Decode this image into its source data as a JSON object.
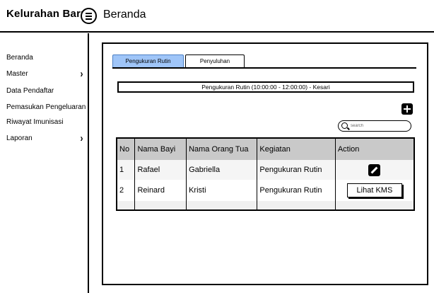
{
  "header": {
    "app_title": "Kelurahan Baru",
    "menu_icon": "hamburger-menu-icon",
    "page_title": "Beranda"
  },
  "sidebar": {
    "items": [
      {
        "label": "Beranda",
        "has_submenu": false
      },
      {
        "label": "Master",
        "has_submenu": true,
        "chevron": "›"
      },
      {
        "label": "Data Pendaftar",
        "has_submenu": false
      },
      {
        "label": "Pemasukan Pengeluaran",
        "has_submenu": false
      },
      {
        "label": "Riwayat Imunisasi",
        "has_submenu": false
      },
      {
        "label": "Laporan",
        "has_submenu": true,
        "chevron": "›"
      }
    ]
  },
  "main": {
    "tabs": [
      {
        "label": "Pengukuran Rutin",
        "active": true
      },
      {
        "label": "Penyuluhan",
        "active": false
      }
    ],
    "info_bar": "Pengukuran Rutin (10:00:00 - 12:00:00) - Kesari",
    "add_icon": "plus-icon",
    "search": {
      "placeholder": "search",
      "value": "",
      "icon": "search-icon"
    },
    "table": {
      "headers": [
        "No",
        "Nama Bayi",
        "Nama Orang Tua",
        "Kegiatan",
        "Action"
      ],
      "rows": [
        {
          "no": "1",
          "nama_bayi": "Rafael",
          "nama_orang_tua": "Gabriella",
          "kegiatan": "Pengukuran Rutin",
          "action": "edit-icon"
        },
        {
          "no": "2",
          "nama_bayi": "Reinard",
          "nama_orang_tua": "Kristi",
          "kegiatan": "Pengukuran Rutin",
          "action_label": "Lihat KMS"
        }
      ]
    }
  },
  "colors": {
    "active_tab": "#9fc5f8",
    "table_header": "#c9c9c9",
    "border": "#000000"
  }
}
